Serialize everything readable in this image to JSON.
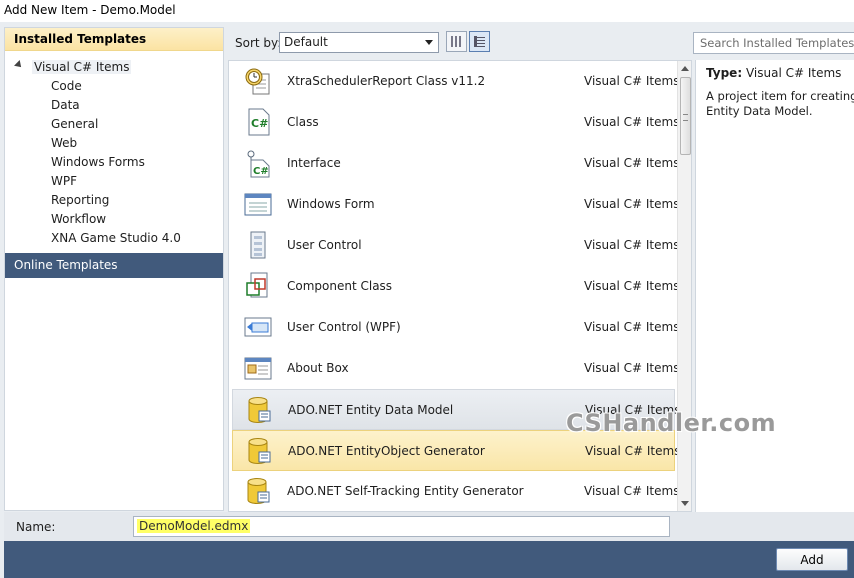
{
  "window": {
    "title": "Add New Item - Demo.Model"
  },
  "left_panel": {
    "installed_header": "Installed Templates",
    "root_node": "Visual C# Items",
    "children": [
      "Code",
      "Data",
      "General",
      "Web",
      "Windows Forms",
      "WPF",
      "Reporting",
      "Workflow",
      "XNA Game Studio 4.0"
    ],
    "online_header": "Online Templates"
  },
  "toolbar": {
    "sort_label": "Sort by:",
    "sort_value": "Default",
    "search_placeholder": "Search Installed Templates"
  },
  "templates": [
    {
      "name": "XtraSchedulerReport Class v11.2",
      "category": "Visual C# Items",
      "icon": "clock-report-icon",
      "state": "normal"
    },
    {
      "name": "Class",
      "category": "Visual C# Items",
      "icon": "csharp-class-icon",
      "state": "normal"
    },
    {
      "name": "Interface",
      "category": "Visual C# Items",
      "icon": "csharp-interface-icon",
      "state": "normal"
    },
    {
      "name": "Windows Form",
      "category": "Visual C# Items",
      "icon": "windows-form-icon",
      "state": "normal"
    },
    {
      "name": "User Control",
      "category": "Visual C# Items",
      "icon": "user-control-icon",
      "state": "normal"
    },
    {
      "name": "Component Class",
      "category": "Visual C# Items",
      "icon": "component-class-icon",
      "state": "normal"
    },
    {
      "name": "User Control (WPF)",
      "category": "Visual C# Items",
      "icon": "wpf-user-control-icon",
      "state": "normal"
    },
    {
      "name": "About Box",
      "category": "Visual C# Items",
      "icon": "about-box-icon",
      "state": "normal"
    },
    {
      "name": "ADO.NET Entity Data Model",
      "category": "Visual C# Items",
      "icon": "database-icon",
      "state": "selected"
    },
    {
      "name": "ADO.NET EntityObject Generator",
      "category": "Visual C# Items",
      "icon": "database-icon",
      "state": "hover"
    },
    {
      "name": "ADO.NET Self-Tracking Entity Generator",
      "category": "Visual C# Items",
      "icon": "database-icon",
      "state": "normal"
    }
  ],
  "details": {
    "type_label": "Type:",
    "type_value": "Visual C# Items",
    "description_line1": "A project item for creating a",
    "description_line2": "Entity Data Model."
  },
  "watermark": "CSHandler.com",
  "name_field": {
    "label": "Name:",
    "value": "DemoModel.edmx"
  },
  "buttons": {
    "add": "Add"
  },
  "colors": {
    "header_yellow": "#fbe3a3",
    "dark_blue": "#415a7c",
    "name_highlight": "#ffff66"
  }
}
